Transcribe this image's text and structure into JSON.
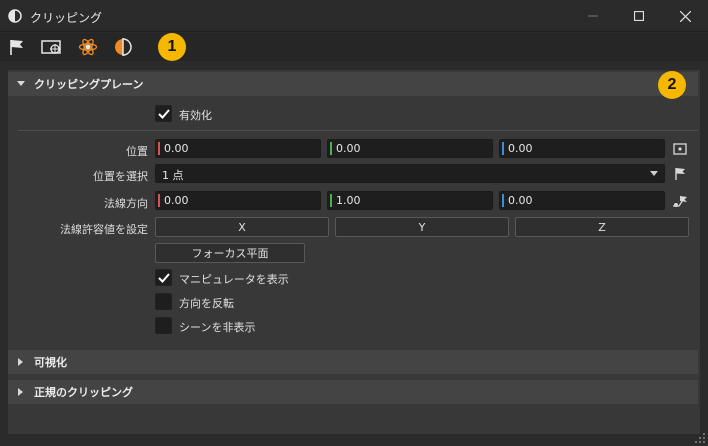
{
  "window": {
    "title": "クリッピング",
    "minimize_icon": "minimize-icon",
    "maximize_icon": "maximize-icon",
    "close_icon": "close-icon"
  },
  "toolbar": {
    "buttons": [
      {
        "name": "flag-icon"
      },
      {
        "name": "camera-target-icon"
      },
      {
        "name": "atom-gear-icon"
      },
      {
        "name": "half-circle-clip-icon",
        "accent": "#f08a24"
      }
    ]
  },
  "badges": {
    "one": "1",
    "two": "2",
    "color": "#f5b700"
  },
  "clipping_plane": {
    "header": "クリッピングプレーン",
    "enabled_label": "有効化",
    "enabled": true,
    "position": {
      "label": "位置",
      "x": "0.00",
      "y": "0.00",
      "z": "0.00"
    },
    "pick_position": {
      "label": "位置を選択",
      "value": "1 点"
    },
    "normal": {
      "label": "法線方向",
      "x": "0.00",
      "y": "1.00",
      "z": "0.00"
    },
    "set_normal": {
      "label": "法線許容値を設定",
      "x": "X",
      "y": "Y",
      "z": "Z"
    },
    "focus_plane_button": "フォーカス平面",
    "show_manipulator": {
      "label": "マニピュレータを表示",
      "checked": true
    },
    "flip_direction": {
      "label": "方向を反転",
      "checked": false
    },
    "hide_scene": {
      "label": "シーンを非表示",
      "checked": false
    }
  },
  "visualize_section": {
    "header": "可視化"
  },
  "regular_clipping_section": {
    "header": "正規のクリッピング"
  },
  "colors": {
    "x_axis": "#d9534f",
    "y_axis": "#4caf50",
    "z_axis": "#3b8fd6"
  }
}
